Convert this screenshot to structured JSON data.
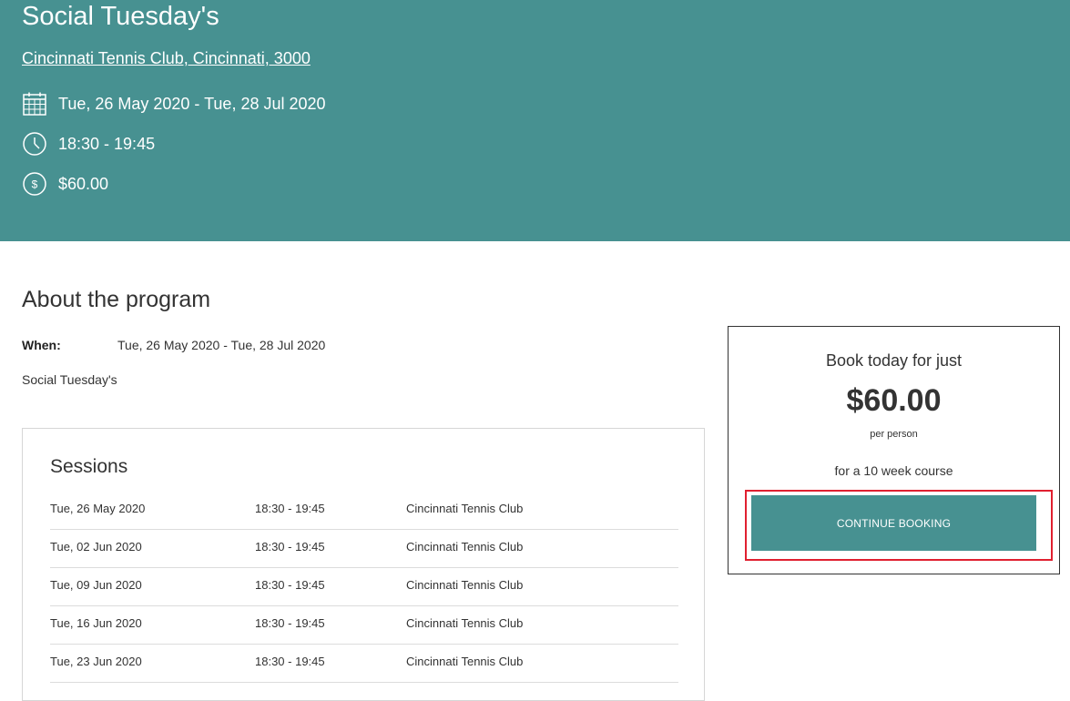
{
  "hero": {
    "title": "Social Tuesday's",
    "location_link": "Cincinnati Tennis Club, Cincinnati, 3000",
    "date_range": "Tue, 26 May 2020 - Tue, 28 Jul 2020",
    "time": "18:30 - 19:45",
    "price": "$60.00",
    "icons": [
      "calendar-icon",
      "clock-icon",
      "dollar-icon"
    ]
  },
  "about": {
    "title": "About the program",
    "when_label": "When:",
    "when_value": "Tue, 26 May 2020 - Tue, 28 Jul 2020",
    "description": "Social Tuesday's"
  },
  "sessions": {
    "title": "Sessions",
    "rows": [
      {
        "date": "Tue, 26 May 2020",
        "time": "18:30 - 19:45",
        "venue": "Cincinnati Tennis Club"
      },
      {
        "date": "Tue, 02 Jun 2020",
        "time": "18:30 - 19:45",
        "venue": "Cincinnati Tennis Club"
      },
      {
        "date": "Tue, 09 Jun 2020",
        "time": "18:30 - 19:45",
        "venue": "Cincinnati Tennis Club"
      },
      {
        "date": "Tue, 16 Jun 2020",
        "time": "18:30 - 19:45",
        "venue": "Cincinnati Tennis Club"
      },
      {
        "date": "Tue, 23 Jun 2020",
        "time": "18:30 - 19:45",
        "venue": "Cincinnati Tennis Club"
      }
    ]
  },
  "booking": {
    "lead": "Book today for just",
    "price": "$60.00",
    "per": "per person",
    "course": "for a 10 week course",
    "button_label": "CONTINUE BOOKING"
  },
  "colors": {
    "accent": "#479191",
    "highlight": "#e02030"
  }
}
